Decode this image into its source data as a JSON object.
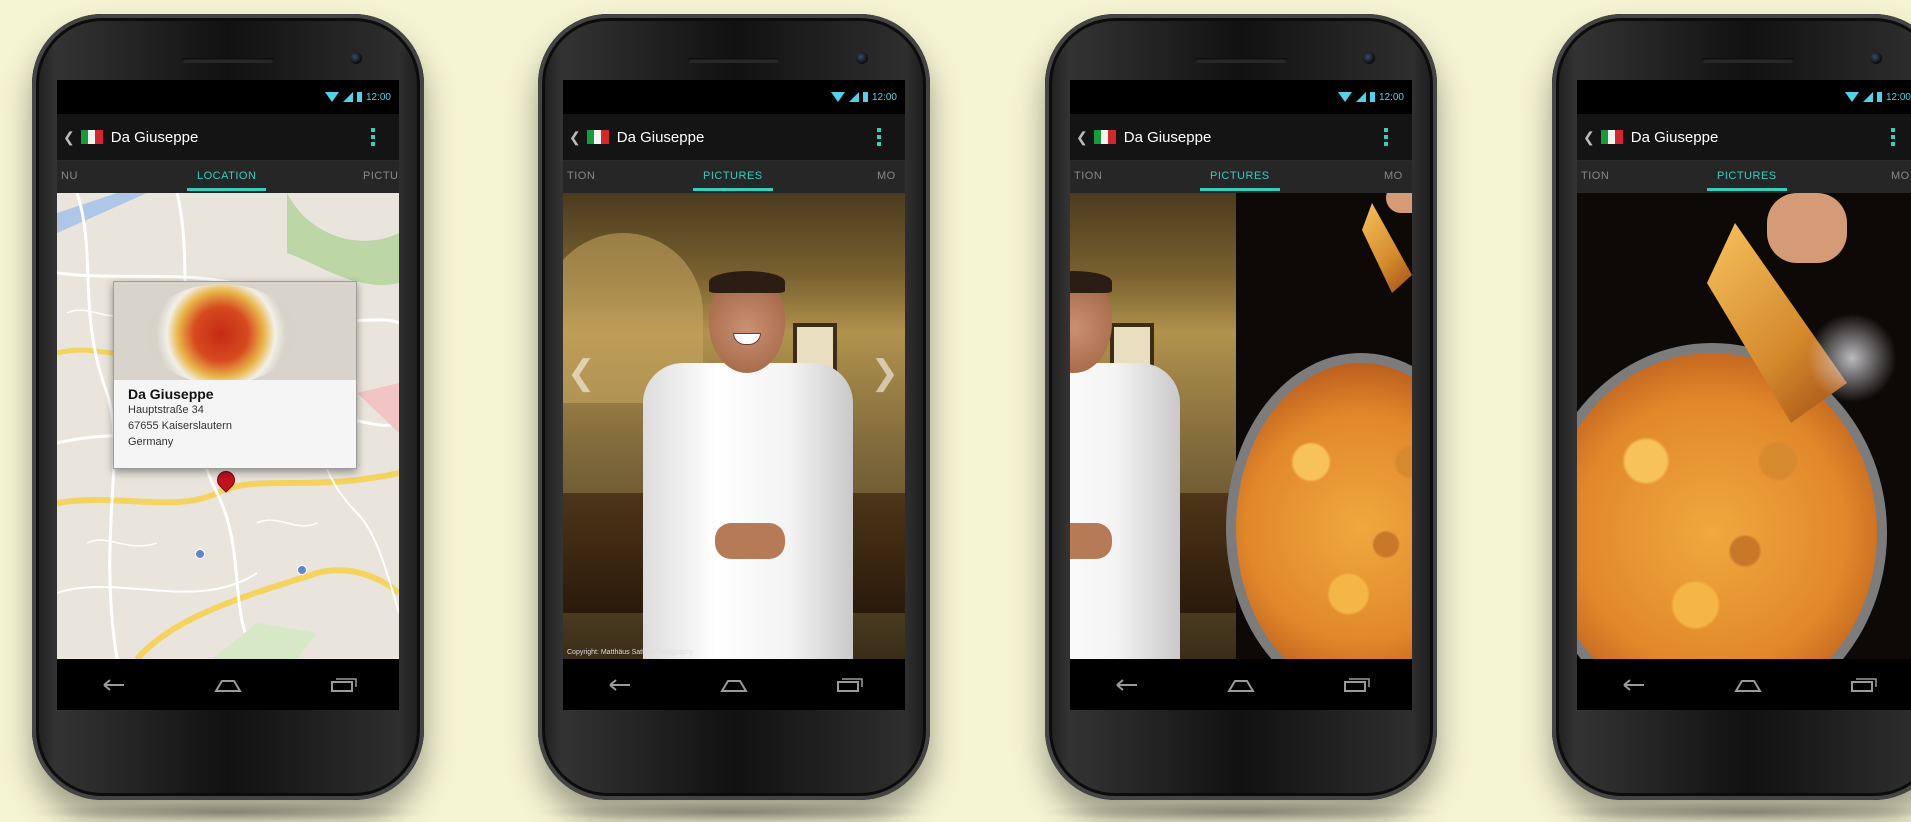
{
  "app": {
    "title": "Da Giuseppe",
    "flag": "italy-flag",
    "accent_color": "#33d0bd",
    "statusbar_color": "#4fd2ea",
    "clock": "12:00"
  },
  "phones": [
    {
      "tabs": {
        "left": "NU",
        "active": "LOCATION",
        "right": "PICTU"
      },
      "map_popup": {
        "name": "Da Giuseppe",
        "street": "Hauptstraße 34",
        "city": "67655 Kaiserslautern",
        "country": "Germany"
      }
    },
    {
      "tabs": {
        "left": "TION",
        "active": "PICTURES",
        "right": "MO"
      },
      "photo": "chef",
      "copyright": "Copyright: Matthäus Sattler Photography"
    },
    {
      "tabs": {
        "left": "TION",
        "active": "PICTURES",
        "right": "MO"
      },
      "photo": "chef-to-pizza-transition"
    },
    {
      "tabs": {
        "left": "TION",
        "active": "PICTURES",
        "right": "MO"
      },
      "photo": "pizza"
    }
  ],
  "navbar": {
    "back": "back-icon",
    "home": "home-icon",
    "recents": "recents-icon"
  }
}
